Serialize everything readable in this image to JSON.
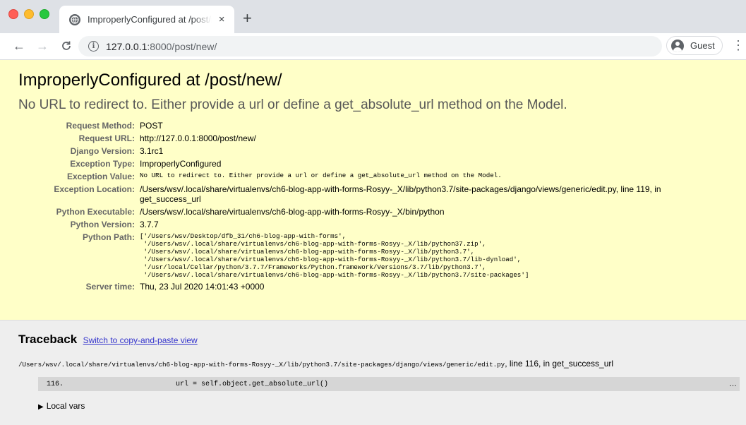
{
  "browser": {
    "tab_title": "ImproperlyConfigured at /post/new/",
    "tab_close": "×",
    "new_tab": "+",
    "url_host": "127.0.0.1",
    "url_rest": ":8000/post/new/",
    "back": "←",
    "forward": "→",
    "reload": "C",
    "info": "i",
    "profile_label": "Guest",
    "menu": "⋮"
  },
  "summary": {
    "title": "ImproperlyConfigured at /post/new/",
    "exception_message": "No URL to redirect to.  Either provide a url or define a get_absolute_url method on the Model.",
    "rows": [
      {
        "label": "Request Method:",
        "value": "POST"
      },
      {
        "label": "Request URL:",
        "value": "http://127.0.0.1:8000/post/new/"
      },
      {
        "label": "Django Version:",
        "value": "3.1rc1"
      },
      {
        "label": "Exception Type:",
        "value": "ImproperlyConfigured"
      },
      {
        "label": "Exception Value:",
        "value": "No URL to redirect to.  Either provide a url or define a get_absolute_url method on the Model."
      },
      {
        "label": "Exception Location:",
        "value": "/Users/wsv/.local/share/virtualenvs/ch6-blog-app-with-forms-Rosyy-_X/lib/python3.7/site-packages/django/views/generic/edit.py, line 119, in get_success_url"
      },
      {
        "label": "Python Executable:",
        "value": "/Users/wsv/.local/share/virtualenvs/ch6-blog-app-with-forms-Rosyy-_X/bin/python"
      },
      {
        "label": "Python Version:",
        "value": "3.7.7"
      },
      {
        "label": "Python Path:",
        "value": "['/Users/wsv/Desktop/dfb_31/ch6-blog-app-with-forms',\n '/Users/wsv/.local/share/virtualenvs/ch6-blog-app-with-forms-Rosyy-_X/lib/python37.zip',\n '/Users/wsv/.local/share/virtualenvs/ch6-blog-app-with-forms-Rosyy-_X/lib/python3.7',\n '/Users/wsv/.local/share/virtualenvs/ch6-blog-app-with-forms-Rosyy-_X/lib/python3.7/lib-dynload',\n '/usr/local/Cellar/python/3.7.7/Frameworks/Python.framework/Versions/3.7/lib/python3.7',\n '/Users/wsv/.local/share/virtualenvs/ch6-blog-app-with-forms-Rosyy-_X/lib/python3.7/site-packages']"
      },
      {
        "label": "Server time:",
        "value": "Thu, 23 Jul 2020 14:01:43 +0000"
      }
    ]
  },
  "traceback": {
    "heading": "Traceback",
    "switch_link": "Switch to copy-and-paste view",
    "frame_path": "/Users/wsv/.local/share/virtualenvs/ch6-blog-app-with-forms-Rosyy-_X/lib/python3.7/site-packages/django/views/generic/edit.py",
    "frame_suffix": ", line 116, in get_success_url",
    "line_number": "116.",
    "line_code": "url = self.object.get_absolute_url()",
    "ellipsis": "…",
    "local_vars": "Local vars"
  }
}
